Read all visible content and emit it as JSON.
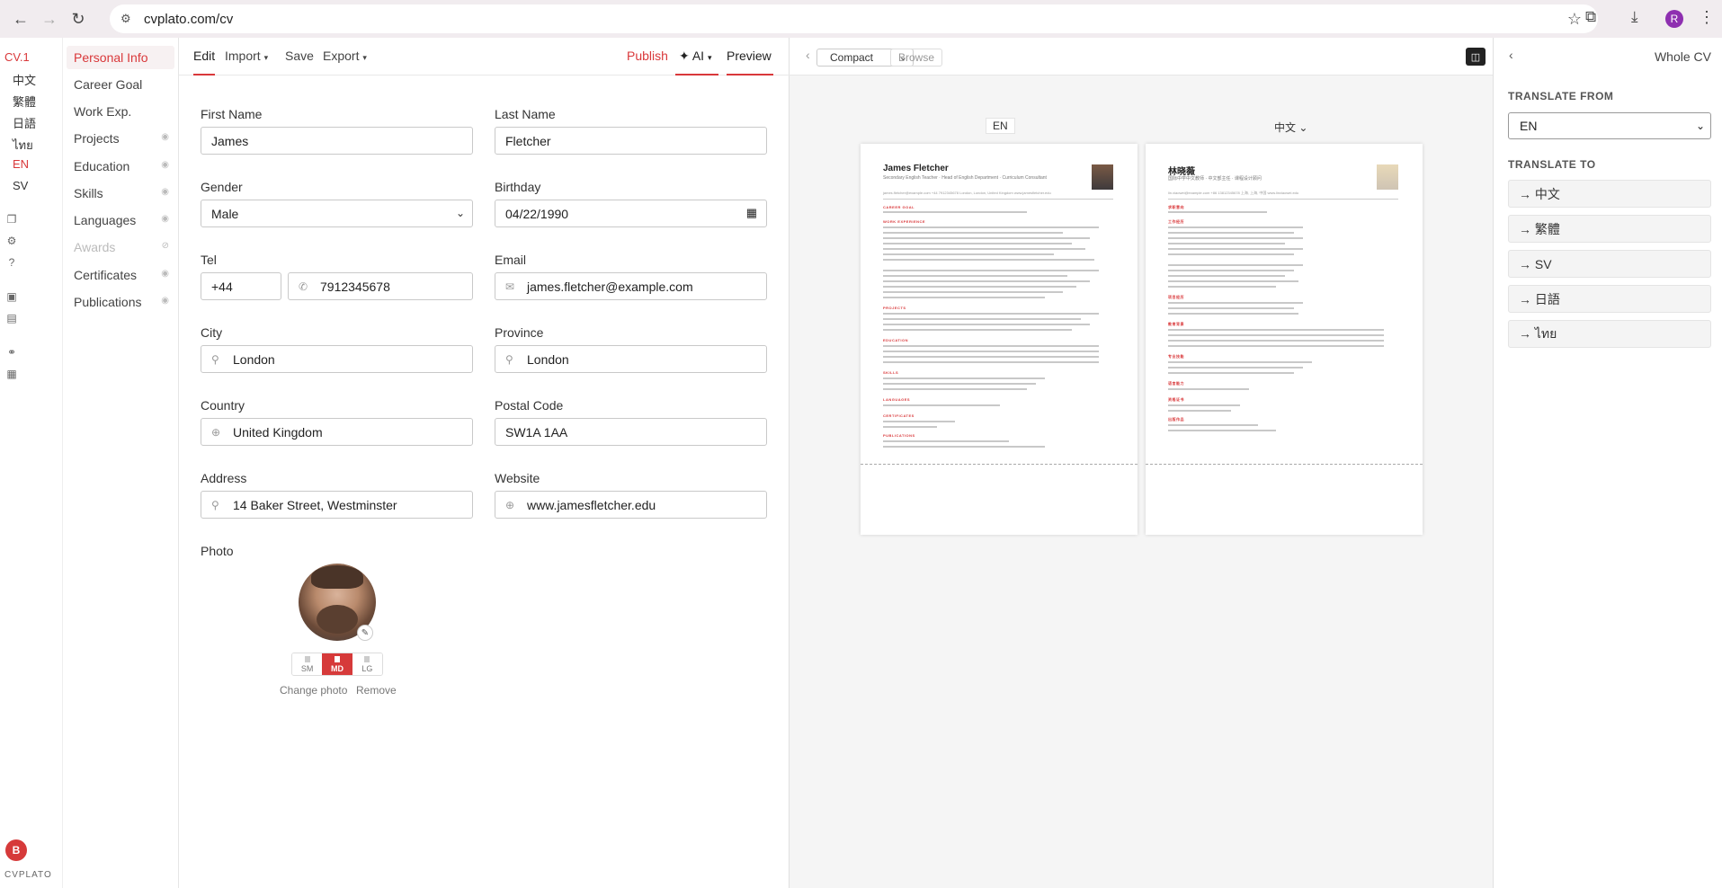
{
  "browser": {
    "url": "cvplato.com/cv",
    "profile_initial": "R"
  },
  "rail": {
    "cv_label": "CV.1",
    "languages": [
      "中文",
      "繁體",
      "日語",
      "ไทย",
      "EN",
      "SV"
    ],
    "active_language": "EN",
    "user_initial": "B",
    "brand": "CVPLATO"
  },
  "sections": [
    {
      "label": "Personal Info",
      "state": "active"
    },
    {
      "label": "Career Goal",
      "state": "normal"
    },
    {
      "label": "Work Exp.",
      "state": "normal"
    },
    {
      "label": "Projects",
      "state": "normal"
    },
    {
      "label": "Education",
      "state": "normal"
    },
    {
      "label": "Skills",
      "state": "normal"
    },
    {
      "label": "Languages",
      "state": "normal"
    },
    {
      "label": "Awards",
      "state": "disabled"
    },
    {
      "label": "Certificates",
      "state": "normal"
    },
    {
      "label": "Publications",
      "state": "normal"
    }
  ],
  "toolbar": {
    "edit": "Edit",
    "import": "Import",
    "save": "Save",
    "export": "Export",
    "publish": "Publish",
    "ai": "✦ AI",
    "preview": "Preview"
  },
  "form": {
    "first_name_label": "First Name",
    "first_name": "James",
    "last_name_label": "Last Name",
    "last_name": "Fletcher",
    "gender_label": "Gender",
    "gender": "Male",
    "birthday_label": "Birthday",
    "birthday": "04/22/1990",
    "tel_label": "Tel",
    "tel_code": "+44",
    "tel_number": "7912345678",
    "email_label": "Email",
    "email": "james.fletcher@example.com",
    "city_label": "City",
    "city": "London",
    "province_label": "Province",
    "province": "London",
    "country_label": "Country",
    "country": "United Kingdom",
    "postal_label": "Postal Code",
    "postal": "SW1A 1AA",
    "address_label": "Address",
    "address": "14 Baker Street, Westminster",
    "website_label": "Website",
    "website": "www.jamesfletcher.edu",
    "photo_label": "Photo",
    "sizes": [
      "SM",
      "MD",
      "LG"
    ],
    "active_size": "MD",
    "change_photo": "Change photo",
    "remove": "Remove"
  },
  "preview": {
    "layout": "Compact",
    "browse": "Browse",
    "left_lang": "EN",
    "right_lang": "中文",
    "left_page": {
      "name": "James Fletcher",
      "subtitle": "Secondary English Teacher · Head of English Department · Curriculum Consultant",
      "contact": "james.fletcher@example.com   +44 7912345678   London, London, United Kingdom   www.jamesfletcher.edu",
      "sections": [
        "CAREER GOAL",
        "WORK EXPERIENCE",
        "PROJECTS",
        "EDUCATION",
        "SKILLS",
        "LANGUAGES",
        "CERTIFICATES",
        "PUBLICATIONS"
      ]
    },
    "right_page": {
      "name": "林晓薇",
      "subtitle": "国际中学中文教师 · 中文部主任 · 课程设计顾问",
      "contact": "lin.xiaowei@example.com   +86 13812345678   上海, 上海, 中国   www.linxiaowei.edu",
      "sections": [
        "求职意向",
        "工作经历",
        "项目经历",
        "教育背景",
        "专业技能",
        "语言能力",
        "资格证书",
        "出版作品"
      ]
    }
  },
  "translate": {
    "title": "Whole CV",
    "from_label": "TRANSLATE FROM",
    "from_value": "EN",
    "to_label": "TRANSLATE TO",
    "targets": [
      "→ 中文",
      "→ 繁體",
      "→ SV",
      "→ 日語",
      "→ ไทย"
    ]
  },
  "colors": {
    "accent": "#d9383a",
    "active_size": "#d63a3a"
  }
}
